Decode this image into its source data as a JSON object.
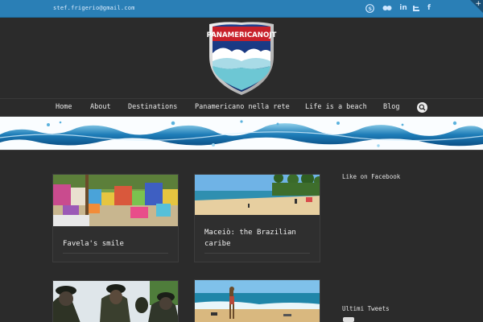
{
  "topbar": {
    "email": "stef.frigerio@gmail.com",
    "social_icons": [
      "skype-icon",
      "flickr-icon",
      "linkedin-icon",
      "twitter-icon",
      "facebook-icon"
    ]
  },
  "logo": {
    "text": "PANAMERICANOJT"
  },
  "nav": {
    "items": [
      "Home",
      "About",
      "Destinations",
      "Panamericano nella rete",
      "Life is a beach",
      "Blog"
    ]
  },
  "posts": [
    {
      "title": "Favela's smile"
    },
    {
      "title": "Maceiò: the Brazilian caribe"
    },
    {
      "title": ""
    },
    {
      "title": ""
    }
  ],
  "sidebar": {
    "facebook_title": "Like on Facebook",
    "tweets_title": "Ultimi Tweets"
  },
  "colors": {
    "topbar": "#2a7fb6",
    "background": "#2b2b2b",
    "card": "#2f2f2f"
  }
}
